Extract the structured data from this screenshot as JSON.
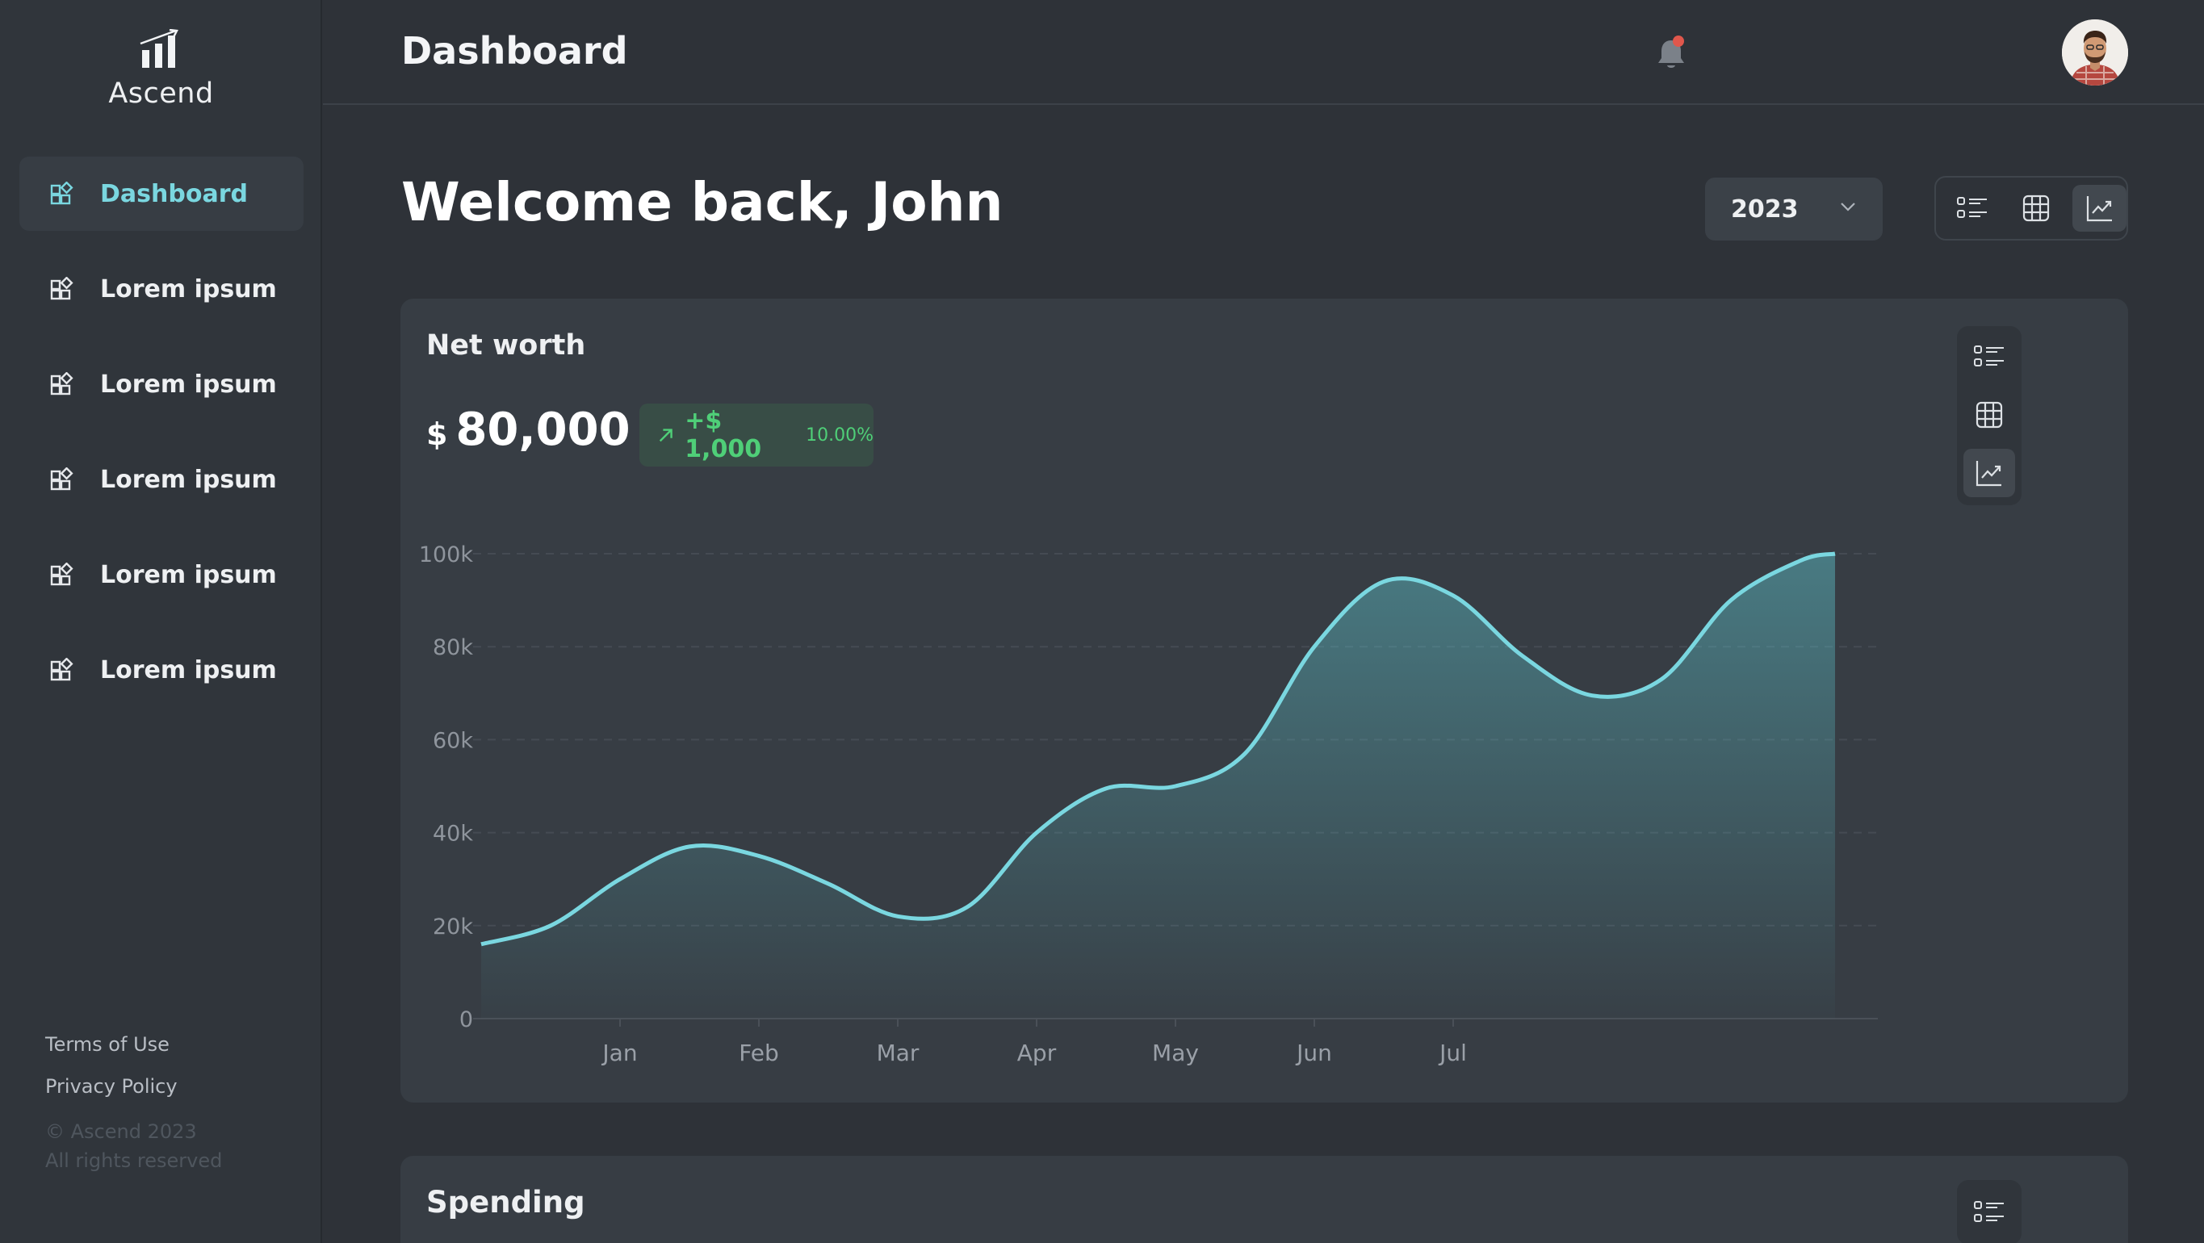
{
  "app": {
    "name": "Ascend"
  },
  "sidebar": {
    "items": [
      {
        "label": "Dashboard",
        "icon": "dashboard-icon",
        "active": true
      },
      {
        "label": "Lorem ipsum",
        "icon": "dashboard-icon"
      },
      {
        "label": "Lorem ipsum",
        "icon": "dashboard-icon"
      },
      {
        "label": "Lorem ipsum",
        "icon": "dashboard-icon"
      },
      {
        "label": "Lorem ipsum",
        "icon": "dashboard-icon"
      },
      {
        "label": "Lorem ipsum",
        "icon": "dashboard-icon"
      }
    ],
    "footer": {
      "terms": "Terms of Use",
      "privacy": "Privacy Policy",
      "copyright_line1": "© Ascend 2023",
      "copyright_line2": "All rights reserved"
    }
  },
  "header": {
    "title": "Dashboard",
    "notification_indicator": true
  },
  "main": {
    "welcome": "Welcome back, John",
    "year_select": {
      "value": "2023"
    },
    "view_toggle": {
      "options": [
        "list-view",
        "grid-view",
        "chart-view"
      ],
      "active": "chart-view"
    }
  },
  "net_worth_card": {
    "title": "Net worth",
    "currency": "$",
    "amount": "80,000",
    "change": "+$ 1,000",
    "change_pct": "10.00%",
    "accent": "#7ad7e0",
    "positive": "#4fcf78"
  },
  "spending_card": {
    "title": "Spending"
  },
  "chart_data": {
    "type": "area",
    "x": [
      "Jan",
      "Feb",
      "Mar",
      "Apr",
      "May",
      "Jun",
      "Jul"
    ],
    "y_ticks": [
      "0",
      "20k",
      "40k",
      "60k",
      "80k",
      "100k"
    ],
    "ylim": [
      0,
      100000
    ],
    "grid": true,
    "series": [
      {
        "points": [
          {
            "x": 0.0,
            "y": 16000
          },
          {
            "x": 0.5,
            "y": 20000
          },
          {
            "x": 1.0,
            "y": 30000
          },
          {
            "x": 1.5,
            "y": 37000
          },
          {
            "x": 2.0,
            "y": 35000
          },
          {
            "x": 2.5,
            "y": 29000
          },
          {
            "x": 3.0,
            "y": 22000
          },
          {
            "x": 3.5,
            "y": 24000
          },
          {
            "x": 4.0,
            "y": 40000
          },
          {
            "x": 4.5,
            "y": 49500
          },
          {
            "x": 5.0,
            "y": 50000
          },
          {
            "x": 5.5,
            "y": 57000
          },
          {
            "x": 6.0,
            "y": 80000
          },
          {
            "x": 6.5,
            "y": 94000
          },
          {
            "x": 7.0,
            "y": 91000
          },
          {
            "x": 7.5,
            "y": 78000
          },
          {
            "x": 8.0,
            "y": 69500
          },
          {
            "x": 8.5,
            "y": 73000
          },
          {
            "x": 9.0,
            "y": 90000
          },
          {
            "x": 9.5,
            "y": 98500
          },
          {
            "x": 9.75,
            "y": 100000
          }
        ]
      }
    ],
    "x_positions": [
      1.0,
      2.0,
      3.0,
      4.0,
      5.0,
      6.0,
      7.0
    ]
  }
}
